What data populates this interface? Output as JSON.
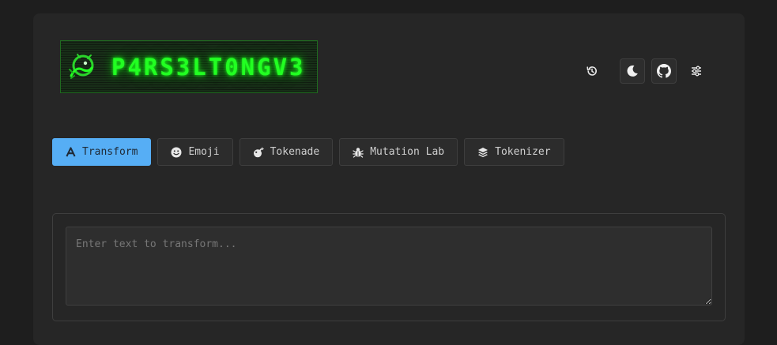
{
  "app": {
    "logo_text": "P4RS3LT0NGV3"
  },
  "header": {
    "history_icon": "history-icon",
    "theme_icon": "moon-icon",
    "github_icon": "github-icon",
    "settings_icon": "sliders-icon"
  },
  "tabs": [
    {
      "label": "Transform",
      "icon": "font-icon",
      "active": true
    },
    {
      "label": "Emoji",
      "icon": "smile-icon",
      "active": false
    },
    {
      "label": "Tokenade",
      "icon": "bomb-icon",
      "active": false
    },
    {
      "label": "Mutation Lab",
      "icon": "bug-icon",
      "active": false
    },
    {
      "label": "Tokenizer",
      "icon": "layers-icon",
      "active": false
    }
  ],
  "input": {
    "placeholder": "Enter text to transform...",
    "value": ""
  },
  "colors": {
    "page_bg": "#1e1e1e",
    "panel_bg": "#262626",
    "accent": "#56aef5",
    "logo_green": "#22ff22"
  }
}
